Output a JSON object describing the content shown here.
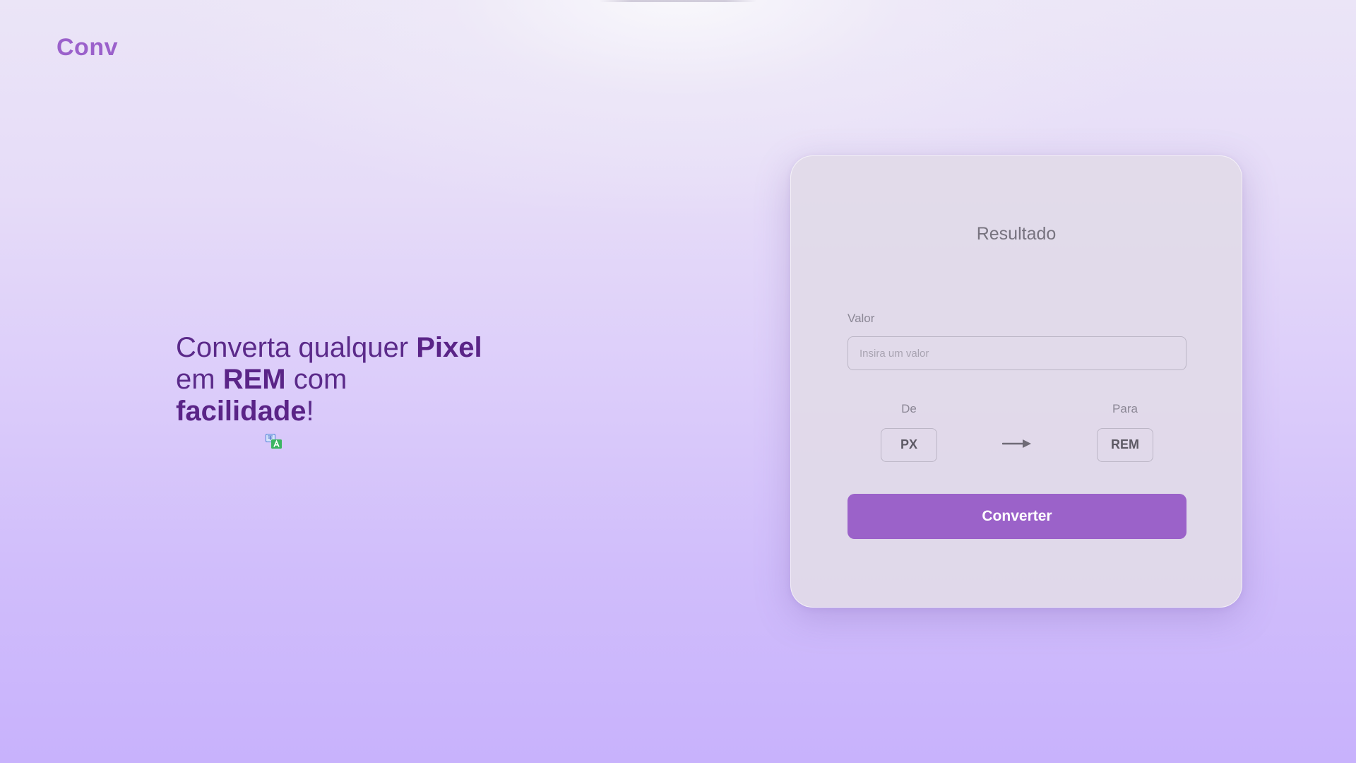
{
  "logo": {
    "text": "Conv"
  },
  "hero": {
    "part1": "Converta qualquer ",
    "part2": "Pixel",
    "part3": "em ",
    "part4": "REM",
    "part5": " com",
    "part6": "facilidade",
    "part7": "!"
  },
  "icons": {
    "translate": "translate-icon",
    "arrow": "arrow-right-icon"
  },
  "card": {
    "title": "Resultado",
    "value_label": "Valor",
    "value_placeholder": "Insira um valor",
    "value": "",
    "from_label": "De",
    "from_unit": "PX",
    "to_label": "Para",
    "to_unit": "REM",
    "convert_label": "Converter"
  },
  "colors": {
    "accent": "#9b62c9",
    "logo": "#9b61cb",
    "hero_text": "#5b2a8a"
  }
}
